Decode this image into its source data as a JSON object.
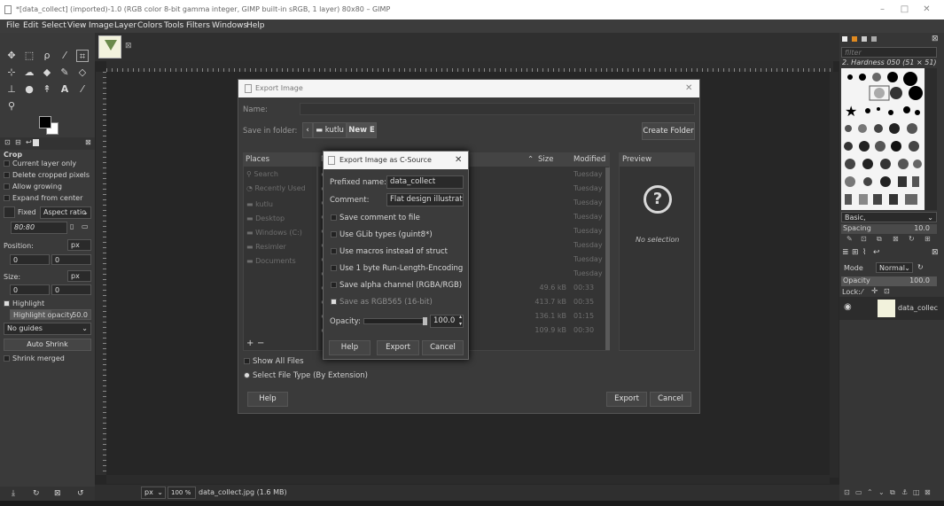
{
  "window": {
    "title": "*[data_collect] (imported)-1.0 (RGB color 8-bit gamma integer, GIMP built-in sRGB, 1 layer) 80x80 – GIMP",
    "minimize": "–",
    "maximize": "□",
    "close": "✕"
  },
  "menu": [
    "File",
    "Edit",
    "Select",
    "View",
    "Image",
    "Layer",
    "Colors",
    "Tools",
    "Filters",
    "Windows",
    "Help"
  ],
  "tool_options": {
    "title": "Crop",
    "current_layer_only": "Current layer only",
    "delete_cropped": "Delete cropped pixels",
    "allow_growing": "Allow growing",
    "expand_center": "Expand from center",
    "fixed": "Fixed",
    "aspect": "Aspect ratio",
    "ratio_value": "80:80",
    "position_label": "Position:",
    "unit_px": "px",
    "pos_x": "0",
    "pos_y": "0",
    "size_label": "Size:",
    "size_x": "0",
    "size_y": "0",
    "highlight": "Highlight",
    "highlight_opacity": "Highlight opacity",
    "highlight_value": "50.0",
    "guides": "No guides",
    "auto_shrink": "Auto Shrink",
    "shrink_merged": "Shrink merged"
  },
  "status": {
    "unit": "px",
    "zoom": "100 %",
    "file": "data_collect.jpg (1.6 MB)"
  },
  "right_panel": {
    "filter_placeholder": "filter",
    "brush_name": "2. Hardness 050 (51 × 51)",
    "preset": "Basic,",
    "spacing_label": "Spacing",
    "spacing_value": "10.0",
    "mode_label": "Mode",
    "mode_value": "Normal",
    "opacity_label": "Opacity",
    "opacity_value": "100.0",
    "lock_label": "Lock:",
    "layer_name": "data_collec"
  },
  "export_dialog": {
    "title": "Export Image",
    "name_label": "Name:",
    "folder_label": "Save in folder:",
    "crumb1": "kutlu",
    "crumb2": "New E",
    "create_folder": "Create Folder",
    "places_header": "Places",
    "name_header": "N",
    "size_header": "Size",
    "modified_header": "Modified",
    "preview_header": "Preview",
    "no_selection": "No selection",
    "places": [
      "Search",
      "Recently Used",
      "kutlu",
      "Desktop",
      "Windows (C:)",
      "Resimler",
      "Documents"
    ],
    "rows": [
      {
        "size": "",
        "mod": "Tuesday"
      },
      {
        "size": "",
        "mod": "Tuesday"
      },
      {
        "size": "",
        "mod": "Tuesday"
      },
      {
        "size": "",
        "mod": "Tuesday"
      },
      {
        "size": "",
        "mod": "Tuesday"
      },
      {
        "size": "",
        "mod": "Tuesday"
      },
      {
        "size": "",
        "mod": "Tuesday"
      },
      {
        "size": "",
        "mod": "Tuesday"
      },
      {
        "size": "49.6 kB",
        "mod": "00:33"
      },
      {
        "size": "413.7 kB",
        "mod": "00:35"
      },
      {
        "size": "136.1 kB",
        "mod": "01:15"
      },
      {
        "size": "109.9 kB",
        "mod": "00:30"
      }
    ],
    "add": "+",
    "remove": "−",
    "show_all": "Show All Files",
    "select_type": "Select File Type (By Extension)",
    "help": "Help",
    "export": "Export",
    "cancel": "Cancel"
  },
  "csource_dialog": {
    "title": "Export Image as C-Source",
    "prefixed_label": "Prefixed name:",
    "prefixed_value": "data_collect",
    "comment_label": "Comment:",
    "comment_value": "Flat design illustratio",
    "save_comment": "Save comment to file",
    "use_glib": "Use GLib types (guint8*)",
    "use_macros": "Use macros instead of struct",
    "use_rle": "Use 1 byte Run-Length-Encoding",
    "save_alpha": "Save alpha channel (RGBA/RGB)",
    "save_rgb565": "Save as RGB565 (16-bit)",
    "opacity_label": "Opacity:",
    "opacity_value": "100.0",
    "help": "Help",
    "export": "Export",
    "cancel": "Cancel"
  }
}
